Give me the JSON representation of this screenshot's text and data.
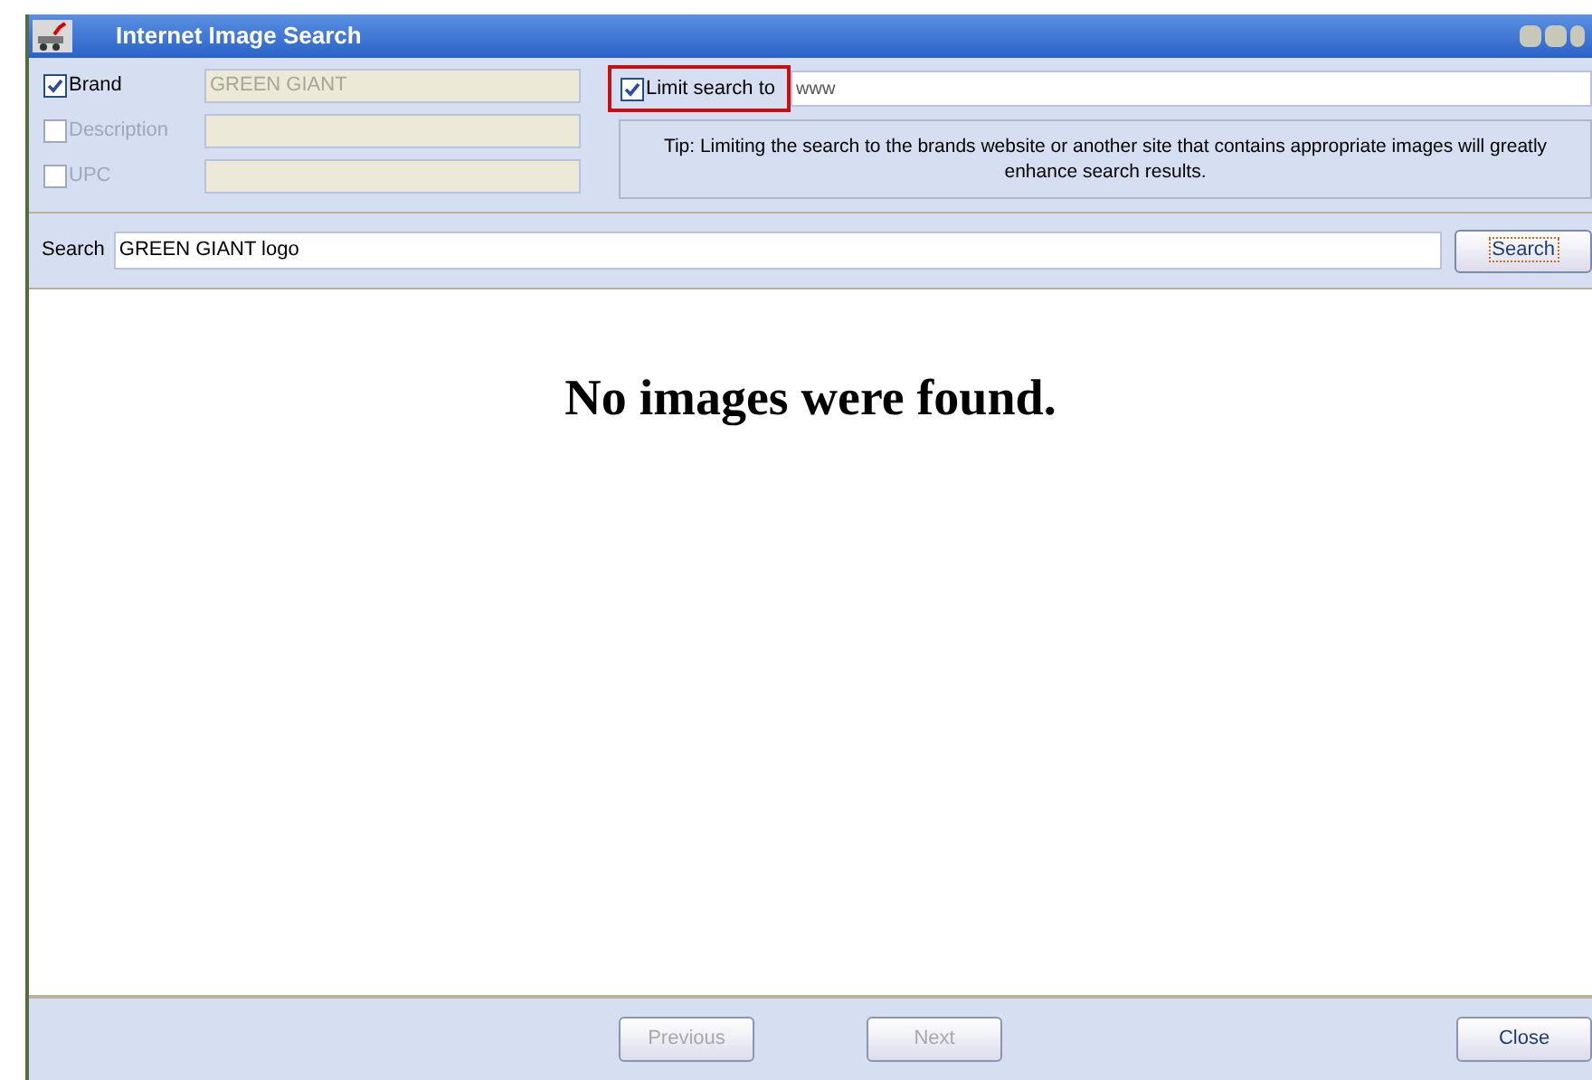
{
  "window": {
    "title": "Internet Image Search"
  },
  "filters": [
    {
      "label": "Brand",
      "checked": true,
      "disabled": false,
      "value": "GREEN GIANT"
    },
    {
      "label": "Description",
      "checked": false,
      "disabled": true
    },
    {
      "label": "UPC",
      "checked": false,
      "disabled": true
    }
  ],
  "limit": {
    "label": "Limit search to",
    "checked": true,
    "value": "www"
  },
  "tip": "Tip: Limiting the search to the brands website or another site that contains appropriate images will greatly enhance search results.",
  "search": {
    "label": "Search",
    "value": "GREEN GIANT logo",
    "button": "Search"
  },
  "results": {
    "message": "No images were found."
  },
  "footer": [
    {
      "label": "Previous",
      "disabled": true
    },
    {
      "label": "Next",
      "disabled": true
    },
    {
      "label": "Close",
      "disabled": false
    }
  ]
}
